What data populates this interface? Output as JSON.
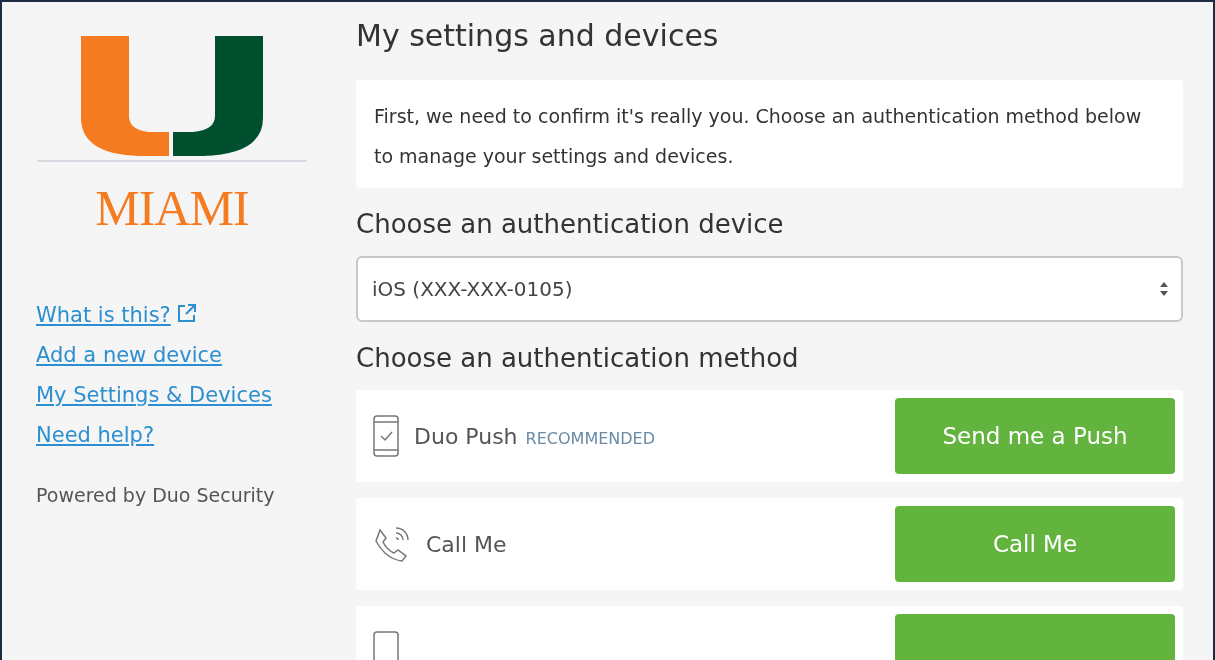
{
  "sidebar": {
    "logo_text": "MIAMI",
    "links": [
      {
        "label": "What is this?",
        "external": true
      },
      {
        "label": "Add a new device",
        "external": false
      },
      {
        "label": "My Settings & Devices",
        "external": false
      },
      {
        "label": "Need help?",
        "external": false
      }
    ],
    "footer": "Powered by Duo Security"
  },
  "main": {
    "title": "My settings and devices",
    "intro": "First, we need to confirm it's really you. Choose an authentication method below to manage your settings and devices.",
    "device_heading": "Choose an authentication device",
    "device_select": {
      "value": "iOS (XXX-XXX-0105)"
    },
    "method_heading": "Choose an authentication method",
    "methods": [
      {
        "kind": "push",
        "label": "Duo Push",
        "badge": "RECOMMENDED",
        "button": "Send me a Push"
      },
      {
        "kind": "call",
        "label": "Call Me",
        "button": "Call Me"
      },
      {
        "kind": "passcode"
      }
    ]
  }
}
